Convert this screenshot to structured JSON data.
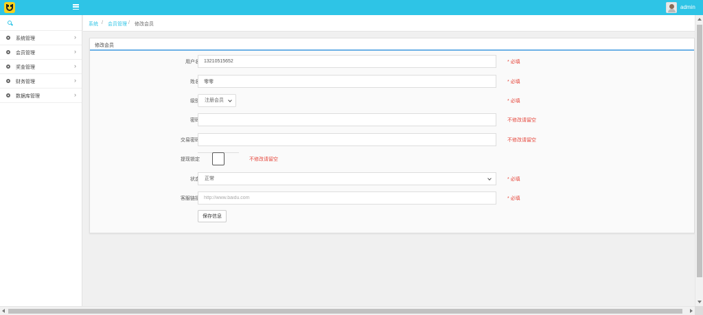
{
  "header": {
    "admin_name": "admin",
    "brand_color": "#2ec4e6",
    "logo_color": "#f7d11c"
  },
  "sidebar": {
    "items": [
      {
        "label": "系统管理"
      },
      {
        "label": "会员管理"
      },
      {
        "label": "奖金管理"
      },
      {
        "label": "财务管理"
      },
      {
        "label": "数据库管理"
      }
    ]
  },
  "breadcrumb": {
    "items": [
      "系统",
      "会员管理",
      "修改会员"
    ],
    "separator": "/"
  },
  "form": {
    "title": "修改会员",
    "username": {
      "label": "用户名",
      "value": "13210515652",
      "hint": "* 必填"
    },
    "name": {
      "label": "姓名",
      "value": "零零",
      "hint": "* 必填"
    },
    "level": {
      "label": "级别",
      "value": "注册会员",
      "hint": "* 必填"
    },
    "password": {
      "label": "密码",
      "value": "",
      "hint": "不修改请留空"
    },
    "trade_password": {
      "label": "交易密码",
      "value": "",
      "hint": "不修改请留空"
    },
    "withdraw_lock": {
      "label": "提现锁定",
      "hint": "不修改请留空"
    },
    "status": {
      "label": "状态",
      "value": "正常",
      "hint": "* 必填"
    },
    "service_link": {
      "label": "客服链接",
      "placeholder": "http://www.baidu.com",
      "hint": "* 必填"
    },
    "save_label": "保存信息",
    "hint_color": "#e5453a"
  }
}
